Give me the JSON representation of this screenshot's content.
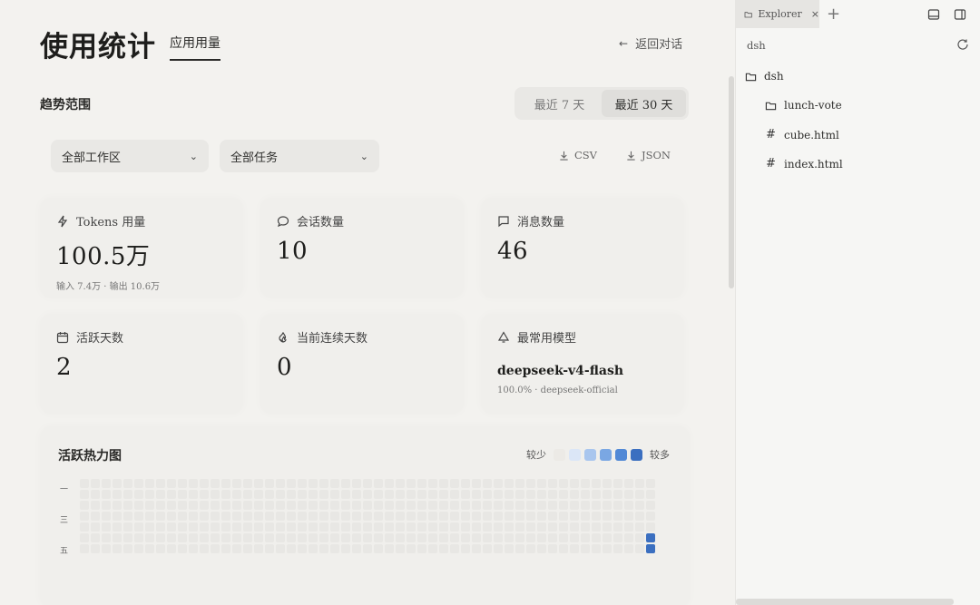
{
  "header": {
    "title": "使用统计",
    "tab_usage": "应用用量",
    "back_label": "返回对话"
  },
  "range": {
    "label": "趋势范围",
    "options": [
      "最近 7 天",
      "最近 30 天"
    ],
    "active_index": 1
  },
  "filters": {
    "workspace": "全部工作区",
    "task": "全部任务",
    "export_csv": "CSV",
    "export_json": "JSON"
  },
  "cards": {
    "tokens": {
      "label": "Tokens 用量",
      "value": "100.5万",
      "sub": "输入 7.4万 · 输出 10.6万",
      "icon": "lightning-icon"
    },
    "sessions": {
      "label": "会话数量",
      "value": "10",
      "icon": "chat-bubble-icon"
    },
    "messages": {
      "label": "消息数量",
      "value": "46",
      "icon": "message-square-icon"
    },
    "active_days": {
      "label": "活跃天数",
      "value": "2",
      "icon": "calendar-icon"
    },
    "streak": {
      "label": "当前连续天数",
      "value": "0",
      "icon": "flame-icon"
    },
    "model": {
      "label": "最常用模型",
      "value": "deepseek-v4-flash",
      "sub": "100.0% · deepseek-official",
      "icon": "bell-icon"
    }
  },
  "heatmap": {
    "title": "活跃热力图",
    "legend_less": "较少",
    "legend_more": "较多",
    "legend_colors": [
      "#eceae6",
      "#dbe6f7",
      "#a9c6ee",
      "#7aa7e3",
      "#5289d6",
      "#3b6fc0"
    ],
    "day_labels": [
      "一",
      "三",
      "五"
    ],
    "weeks": 53,
    "rows": 7,
    "empty_color": "#e8e7e4",
    "active_cells": [
      {
        "week": 52,
        "day": 5,
        "level": 4
      },
      {
        "week": 52,
        "day": 6,
        "level": 4
      }
    ]
  },
  "explorer": {
    "tab_label": "Explorer",
    "path": "dsh",
    "root_folder": "dsh",
    "items": [
      {
        "name": "lunch-vote",
        "type": "folder"
      },
      {
        "name": "cube.html",
        "type": "file"
      },
      {
        "name": "index.html",
        "type": "file"
      }
    ]
  }
}
